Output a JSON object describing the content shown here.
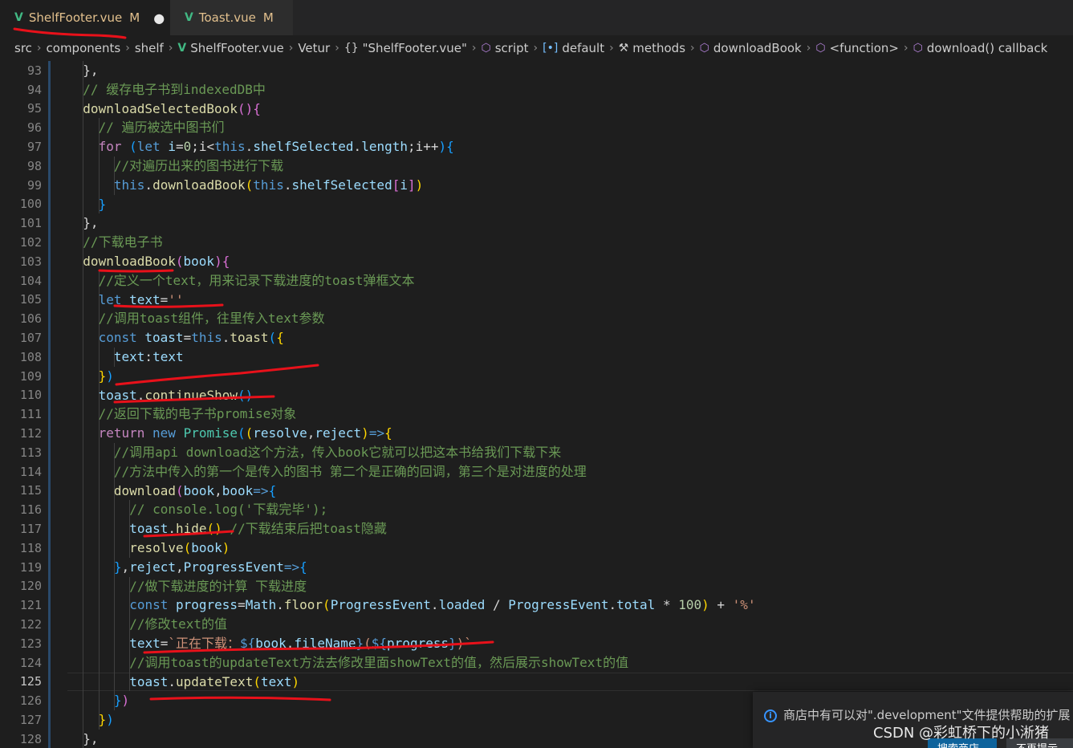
{
  "tabs": [
    {
      "label": "ShelfFooter.vue",
      "status": "M",
      "dirty": "●",
      "active": true
    },
    {
      "label": "Toast.vue",
      "status": "M",
      "active": false
    }
  ],
  "breadcrumb": [
    {
      "label": "src",
      "icon": ""
    },
    {
      "label": "components",
      "icon": ""
    },
    {
      "label": "shelf",
      "icon": ""
    },
    {
      "label": "ShelfFooter.vue",
      "icon": "vue-icon"
    },
    {
      "label": "Vetur",
      "icon": ""
    },
    {
      "label": "\"ShelfFooter.vue\"",
      "icon": "braces-icon"
    },
    {
      "label": "script",
      "icon": "cube-icon"
    },
    {
      "label": "default",
      "icon": "variable-icon"
    },
    {
      "label": "methods",
      "icon": "wrench-icon"
    },
    {
      "label": "downloadBook",
      "icon": "cube-icon"
    },
    {
      "label": "<function>",
      "icon": "cube-icon"
    },
    {
      "label": "download() callback",
      "icon": "cube-icon"
    }
  ],
  "current_line": 125,
  "lines": [
    {
      "num": "93",
      "indent": 2,
      "tokens": [
        [
          "},",
          "t-plain"
        ]
      ]
    },
    {
      "num": "94",
      "indent": 2,
      "tokens": [
        [
          "// 缓存电子书到indexedDB中",
          "t-com"
        ]
      ]
    },
    {
      "num": "95",
      "indent": 2,
      "tokens": [
        [
          "downloadSelectedBook",
          "t-fn"
        ],
        [
          "()",
          "t-p2"
        ],
        [
          "{",
          "t-p2"
        ]
      ]
    },
    {
      "num": "96",
      "indent": 3,
      "tokens": [
        [
          "// 遍历被选中图书们",
          "t-com"
        ]
      ]
    },
    {
      "num": "97",
      "indent": 3,
      "tokens": [
        [
          "for",
          "t-ctl"
        ],
        [
          " ",
          "t-plain"
        ],
        [
          "(",
          "t-p3"
        ],
        [
          "let",
          "t-kw"
        ],
        [
          " i",
          "t-var"
        ],
        [
          "=",
          "t-plain"
        ],
        [
          "0",
          "t-num"
        ],
        [
          ";i<",
          "t-plain"
        ],
        [
          "this",
          "t-kw"
        ],
        [
          ".",
          "t-plain"
        ],
        [
          "shelfSelected",
          "t-var"
        ],
        [
          ".",
          "t-plain"
        ],
        [
          "length",
          "t-var"
        ],
        [
          ";i++",
          "t-plain"
        ],
        [
          ")",
          "t-p3"
        ],
        [
          "{",
          "t-p3"
        ]
      ]
    },
    {
      "num": "98",
      "indent": 4,
      "tokens": [
        [
          "//对遍历出来的图书进行下载",
          "t-com"
        ]
      ]
    },
    {
      "num": "99",
      "indent": 4,
      "tokens": [
        [
          "this",
          "t-kw"
        ],
        [
          ".",
          "t-plain"
        ],
        [
          "downloadBook",
          "t-fn"
        ],
        [
          "(",
          "t-p1"
        ],
        [
          "this",
          "t-kw"
        ],
        [
          ".",
          "t-plain"
        ],
        [
          "shelfSelected",
          "t-var"
        ],
        [
          "[",
          "t-p2"
        ],
        [
          "i",
          "t-var"
        ],
        [
          "]",
          "t-p2"
        ],
        [
          ")",
          "t-p1"
        ]
      ]
    },
    {
      "num": "100",
      "indent": 3,
      "tokens": [
        [
          "}",
          "t-p3"
        ]
      ]
    },
    {
      "num": "101",
      "indent": 2,
      "tokens": [
        [
          "},",
          "t-plain"
        ]
      ]
    },
    {
      "num": "102",
      "indent": 2,
      "tokens": [
        [
          "//下载电子书",
          "t-com"
        ]
      ]
    },
    {
      "num": "103",
      "indent": 2,
      "tokens": [
        [
          "downloadBook",
          "t-fn"
        ],
        [
          "(",
          "t-p2"
        ],
        [
          "book",
          "t-var"
        ],
        [
          ")",
          "t-p2"
        ],
        [
          "{",
          "t-p2"
        ]
      ]
    },
    {
      "num": "104",
      "indent": 3,
      "tokens": [
        [
          "//定义一个text，用来记录下载进度的toast弹框文本",
          "t-com"
        ]
      ]
    },
    {
      "num": "105",
      "indent": 3,
      "tokens": [
        [
          "let",
          "t-kw"
        ],
        [
          " text",
          "t-var"
        ],
        [
          "=",
          "t-plain"
        ],
        [
          "''",
          "t-str"
        ]
      ]
    },
    {
      "num": "106",
      "indent": 3,
      "tokens": [
        [
          "//调用toast组件，往里传入text参数",
          "t-com"
        ]
      ]
    },
    {
      "num": "107",
      "indent": 3,
      "tokens": [
        [
          "const",
          "t-kw"
        ],
        [
          " toast",
          "t-var"
        ],
        [
          "=",
          "t-plain"
        ],
        [
          "this",
          "t-kw"
        ],
        [
          ".",
          "t-plain"
        ],
        [
          "toast",
          "t-fn"
        ],
        [
          "(",
          "t-p3"
        ],
        [
          "{",
          "t-p1"
        ]
      ]
    },
    {
      "num": "108",
      "indent": 4,
      "tokens": [
        [
          "text",
          "t-var"
        ],
        [
          ":",
          "t-plain"
        ],
        [
          "text",
          "t-var"
        ]
      ]
    },
    {
      "num": "109",
      "indent": 3,
      "tokens": [
        [
          "}",
          "t-p1"
        ],
        [
          ")",
          "t-p3"
        ]
      ]
    },
    {
      "num": "110",
      "indent": 3,
      "tokens": [
        [
          "toast",
          "t-var"
        ],
        [
          ".",
          "t-plain"
        ],
        [
          "continueShow",
          "t-fn"
        ],
        [
          "()",
          "t-p3"
        ]
      ]
    },
    {
      "num": "111",
      "indent": 3,
      "tokens": [
        [
          "//返回下载的电子书promise对象",
          "t-com"
        ]
      ]
    },
    {
      "num": "112",
      "indent": 3,
      "tokens": [
        [
          "return",
          "t-ctl"
        ],
        [
          " ",
          "t-plain"
        ],
        [
          "new",
          "t-kw"
        ],
        [
          " ",
          "t-plain"
        ],
        [
          "Promise",
          "t-cls"
        ],
        [
          "(",
          "t-p3"
        ],
        [
          "(",
          "t-p1"
        ],
        [
          "resolve",
          "t-var"
        ],
        [
          ",",
          "t-plain"
        ],
        [
          "reject",
          "t-var"
        ],
        [
          ")",
          "t-p1"
        ],
        [
          "=>",
          "t-kw"
        ],
        [
          "{",
          "t-p1"
        ]
      ]
    },
    {
      "num": "113",
      "indent": 4,
      "tokens": [
        [
          "//调用api download这个方法，传入book它就可以把这本书给我们下载下来",
          "t-com"
        ]
      ]
    },
    {
      "num": "114",
      "indent": 4,
      "tokens": [
        [
          "//方法中传入的第一个是传入的图书 第二个是正确的回调，第三个是对进度的处理",
          "t-com"
        ]
      ]
    },
    {
      "num": "115",
      "indent": 4,
      "tokens": [
        [
          "download",
          "t-fn"
        ],
        [
          "(",
          "t-p2"
        ],
        [
          "book",
          "t-var"
        ],
        [
          ",",
          "t-plain"
        ],
        [
          "book",
          "t-var"
        ],
        [
          "=>",
          "t-kw"
        ],
        [
          "{",
          "t-p3"
        ]
      ]
    },
    {
      "num": "116",
      "indent": 5,
      "tokens": [
        [
          "// console.log('下载完毕');",
          "t-com"
        ]
      ]
    },
    {
      "num": "117",
      "indent": 5,
      "tokens": [
        [
          "toast",
          "t-var"
        ],
        [
          ".",
          "t-plain"
        ],
        [
          "hide",
          "t-fn"
        ],
        [
          "()",
          "t-p1"
        ],
        [
          " ",
          "t-plain"
        ],
        [
          "//下载结束后把toast隐藏",
          "t-com"
        ]
      ]
    },
    {
      "num": "118",
      "indent": 5,
      "tokens": [
        [
          "resolve",
          "t-fn"
        ],
        [
          "(",
          "t-p1"
        ],
        [
          "book",
          "t-var"
        ],
        [
          ")",
          "t-p1"
        ]
      ]
    },
    {
      "num": "119",
      "indent": 4,
      "tokens": [
        [
          "}",
          "t-p3"
        ],
        [
          ",",
          "t-plain"
        ],
        [
          "reject",
          "t-var"
        ],
        [
          ",",
          "t-plain"
        ],
        [
          "ProgressEvent",
          "t-var"
        ],
        [
          "=>",
          "t-kw"
        ],
        [
          "{",
          "t-p3"
        ]
      ]
    },
    {
      "num": "120",
      "indent": 5,
      "tokens": [
        [
          "//做下载进度的计算 下载进度",
          "t-com"
        ]
      ]
    },
    {
      "num": "121",
      "indent": 5,
      "tokens": [
        [
          "const",
          "t-kw"
        ],
        [
          " progress",
          "t-var"
        ],
        [
          "=",
          "t-plain"
        ],
        [
          "Math",
          "t-var"
        ],
        [
          ".",
          "t-plain"
        ],
        [
          "floor",
          "t-fn"
        ],
        [
          "(",
          "t-p1"
        ],
        [
          "ProgressEvent",
          "t-var"
        ],
        [
          ".",
          "t-plain"
        ],
        [
          "loaded",
          "t-var"
        ],
        [
          " / ",
          "t-plain"
        ],
        [
          "ProgressEvent",
          "t-var"
        ],
        [
          ".",
          "t-plain"
        ],
        [
          "total",
          "t-var"
        ],
        [
          " * ",
          "t-plain"
        ],
        [
          "100",
          "t-num"
        ],
        [
          ")",
          "t-p1"
        ],
        [
          " + ",
          "t-plain"
        ],
        [
          "'%'",
          "t-str"
        ]
      ]
    },
    {
      "num": "122",
      "indent": 5,
      "tokens": [
        [
          "//修改text的值",
          "t-com"
        ]
      ]
    },
    {
      "num": "123",
      "indent": 5,
      "tokens": [
        [
          "text",
          "t-var"
        ],
        [
          "=",
          "t-plain"
        ],
        [
          "`正在下载：",
          "t-str"
        ],
        [
          "${",
          "t-kw"
        ],
        [
          "book",
          "t-var"
        ],
        [
          ".",
          "t-plain"
        ],
        [
          "fileName",
          "t-var"
        ],
        [
          "}",
          "t-kw"
        ],
        [
          "(",
          "t-str"
        ],
        [
          "${",
          "t-kw"
        ],
        [
          "progress",
          "t-var"
        ],
        [
          "}",
          "t-kw"
        ],
        [
          ")`",
          "t-str"
        ]
      ]
    },
    {
      "num": "124",
      "indent": 5,
      "tokens": [
        [
          "//调用toast的updateText方法去修改里面showText的值，然后展示showText的值",
          "t-com"
        ]
      ]
    },
    {
      "num": "125",
      "indent": 5,
      "tokens": [
        [
          "toast",
          "t-var"
        ],
        [
          ".",
          "t-plain"
        ],
        [
          "updateText",
          "t-fn"
        ],
        [
          "(",
          "t-p1"
        ],
        [
          "text",
          "t-var"
        ],
        [
          ")",
          "t-p1"
        ]
      ]
    },
    {
      "num": "126",
      "indent": 4,
      "tokens": [
        [
          "}",
          "t-p3"
        ],
        [
          ")",
          "t-p2"
        ]
      ]
    },
    {
      "num": "127",
      "indent": 3,
      "tokens": [
        [
          "}",
          "t-p1"
        ],
        [
          ")",
          "t-p3"
        ]
      ]
    },
    {
      "num": "128",
      "indent": 2,
      "tokens": [
        [
          "},",
          "t-plain"
        ]
      ]
    }
  ],
  "notification": {
    "icon": "info-icon",
    "message": "商店中有可以对\".development\"文件提供帮助的扩展",
    "primary_button": "搜索商店",
    "secondary_button": "不再提示"
  },
  "watermark": "CSDN @彩虹桥下的小淅猪",
  "colors": {
    "annotation": "#e8111a",
    "accent": "#3794ff",
    "vue": "#41b883"
  }
}
